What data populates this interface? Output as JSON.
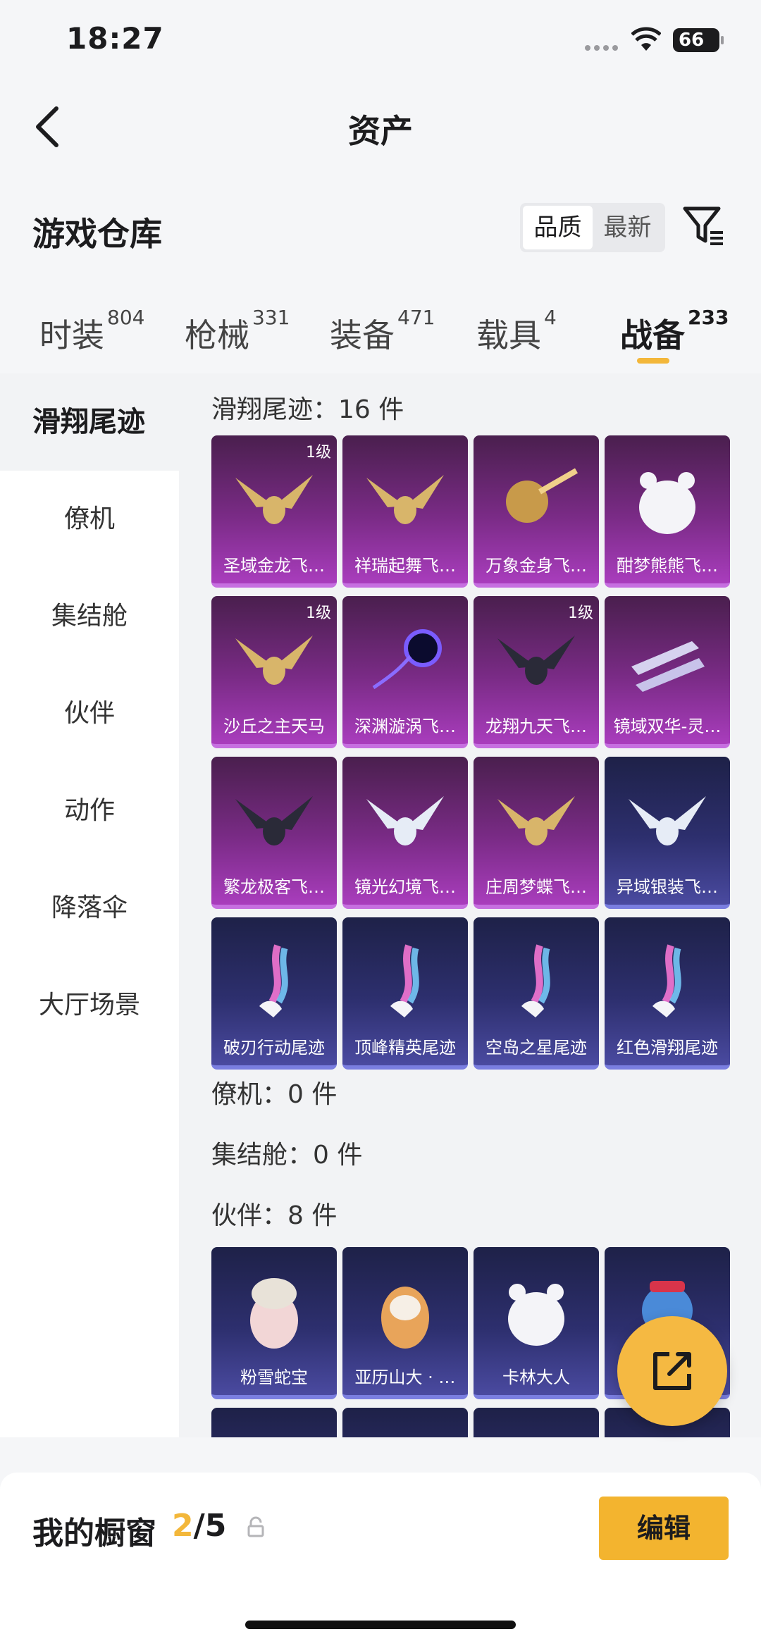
{
  "status": {
    "time": "18:27",
    "battery": "66"
  },
  "header": {
    "title": "资产"
  },
  "warehouse": {
    "title": "游戏仓库",
    "sort": [
      "品质",
      "最新"
    ]
  },
  "tabs": [
    {
      "label": "时装",
      "count": "804"
    },
    {
      "label": "枪械",
      "count": "331"
    },
    {
      "label": "装备",
      "count": "471"
    },
    {
      "label": "载具",
      "count": "4"
    },
    {
      "label": "战备",
      "count": "233"
    }
  ],
  "sidebar": [
    "滑翔尾迹",
    "僚机",
    "集结舱",
    "伙伴",
    "动作",
    "降落伞",
    "大厅场景"
  ],
  "groups": {
    "glide": "滑翔尾迹：16 件",
    "wingman": "僚机：0 件",
    "pod": "集结舱：0 件",
    "partner": "伙伴：8 件"
  },
  "glide_items": [
    {
      "name": "圣域金龙飞…",
      "level": "1级",
      "color": "purple",
      "icon": "dragon-icon"
    },
    {
      "name": "祥瑞起舞飞…",
      "level": "",
      "color": "purple",
      "icon": "star-wings-icon"
    },
    {
      "name": "万象金身飞…",
      "level": "",
      "color": "purple",
      "icon": "golden-comet-icon"
    },
    {
      "name": "酣梦熊熊飞…",
      "level": "",
      "color": "purple",
      "icon": "bear-icon"
    },
    {
      "name": "沙丘之主天马",
      "level": "1级",
      "color": "purple",
      "icon": "pegasus-icon"
    },
    {
      "name": "深渊漩涡飞…",
      "level": "",
      "color": "purple",
      "icon": "vortex-icon"
    },
    {
      "name": "龙翔九天飞…",
      "level": "1级",
      "color": "purple",
      "icon": "black-dragon-icon"
    },
    {
      "name": "镜域双华-灵…",
      "level": "",
      "color": "purple",
      "icon": "crystal-icon"
    },
    {
      "name": "繁龙极客飞…",
      "level": "",
      "color": "purple",
      "icon": "dark-wing-icon"
    },
    {
      "name": "镜光幻境飞…",
      "level": "",
      "color": "purple",
      "icon": "white-wing-icon"
    },
    {
      "name": "庄周梦蝶飞…",
      "level": "",
      "color": "purple",
      "icon": "butterfly-icon"
    },
    {
      "name": "异域银装飞…",
      "level": "",
      "color": "blue",
      "icon": "silver-wing-icon"
    },
    {
      "name": "破刃行动尾迹",
      "level": "",
      "color": "blue",
      "icon": "trail-icon"
    },
    {
      "name": "顶峰精英尾迹",
      "level": "",
      "color": "blue",
      "icon": "trail-icon"
    },
    {
      "name": "空岛之星尾迹",
      "level": "",
      "color": "blue",
      "icon": "trail-icon"
    },
    {
      "name": "红色滑翔尾迹",
      "level": "",
      "color": "blue",
      "icon": "trail-icon"
    }
  ],
  "partner_items": [
    {
      "name": "粉雪蛇宝",
      "color": "blue",
      "icon": "snake-doll-icon"
    },
    {
      "name": "亚历山大 · …",
      "color": "blue",
      "icon": "tiger-icon"
    },
    {
      "name": "卡林大人",
      "color": "blue",
      "icon": "cat-icon"
    },
    {
      "name": "",
      "color": "blue",
      "icon": "robot-icon"
    }
  ],
  "showcase": {
    "label": "我的橱窗",
    "current": "2",
    "total": "/5",
    "edit": "编辑"
  },
  "colors": {
    "accent": "#f3b73a",
    "purple_card": "#7a2b86",
    "blue_card": "#2d2f6e"
  }
}
